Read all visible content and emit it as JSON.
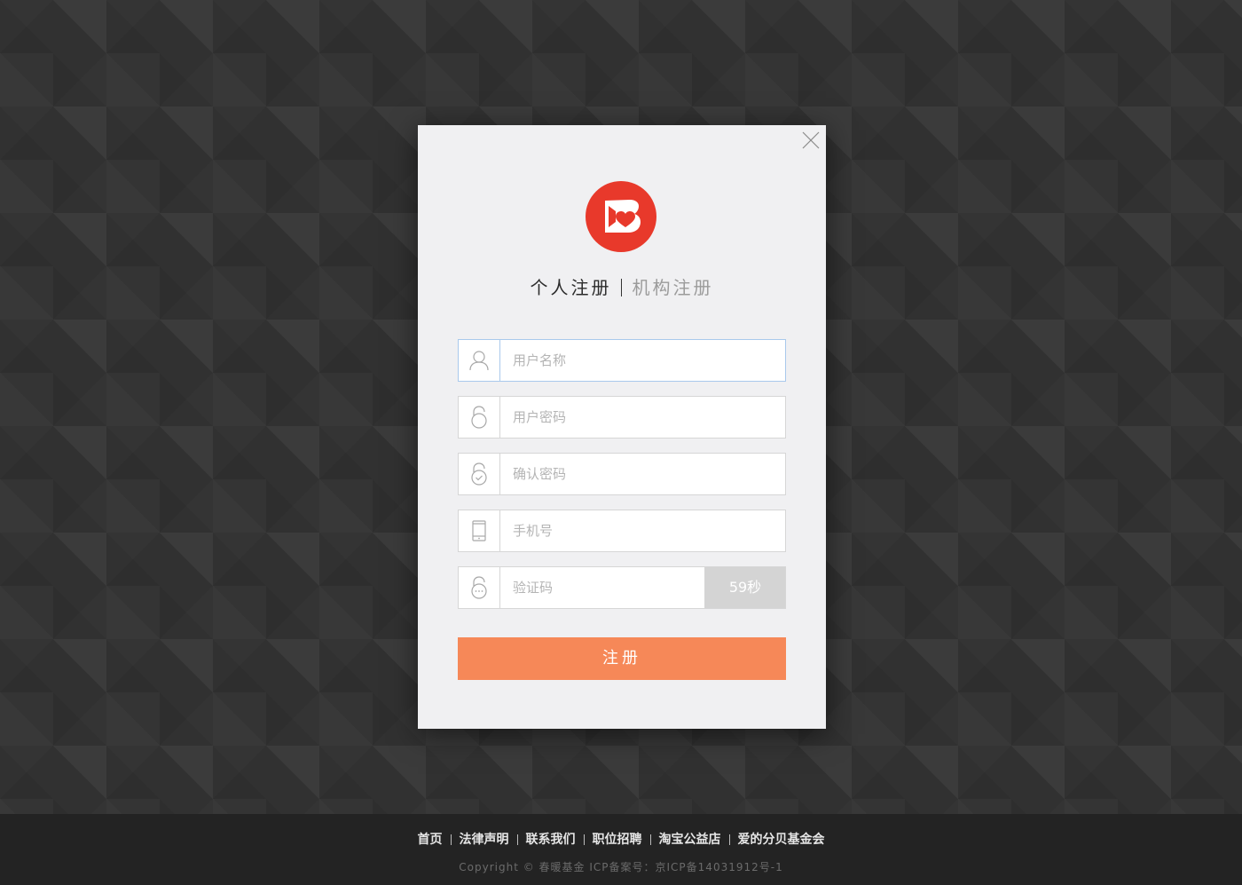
{
  "modal": {
    "tabs": [
      {
        "label": "个人注册",
        "active": true
      },
      {
        "label": "机构注册",
        "active": false
      }
    ],
    "fields": {
      "username": {
        "placeholder": "用户名称",
        "value": "",
        "icon": "user-icon"
      },
      "password": {
        "placeholder": "用户密码",
        "value": "",
        "icon": "lock-icon"
      },
      "confirm_password": {
        "placeholder": "确认密码",
        "value": "",
        "icon": "lock-check-icon"
      },
      "phone": {
        "placeholder": "手机号",
        "value": "",
        "icon": "phone-icon"
      },
      "verify_code": {
        "placeholder": "验证码",
        "value": "",
        "icon": "lock-dots-icon"
      }
    },
    "code_button_label": "59秒",
    "submit_label": "注册",
    "logo_icon": "heart-logo-icon",
    "close_icon": "close-icon"
  },
  "footer": {
    "links": [
      "首页",
      "法律声明",
      "联系我们",
      "职位招聘",
      "淘宝公益店",
      "爱的分贝基金会"
    ],
    "copyright": "Copyright © 春暖基金 ICP备案号：京ICP备14031912号-1"
  },
  "colors": {
    "accent": "#f68858",
    "logo_red": "#e8392b",
    "background": "#333333",
    "modal_bg": "#f0f0f2",
    "footer_bg": "#232323"
  }
}
